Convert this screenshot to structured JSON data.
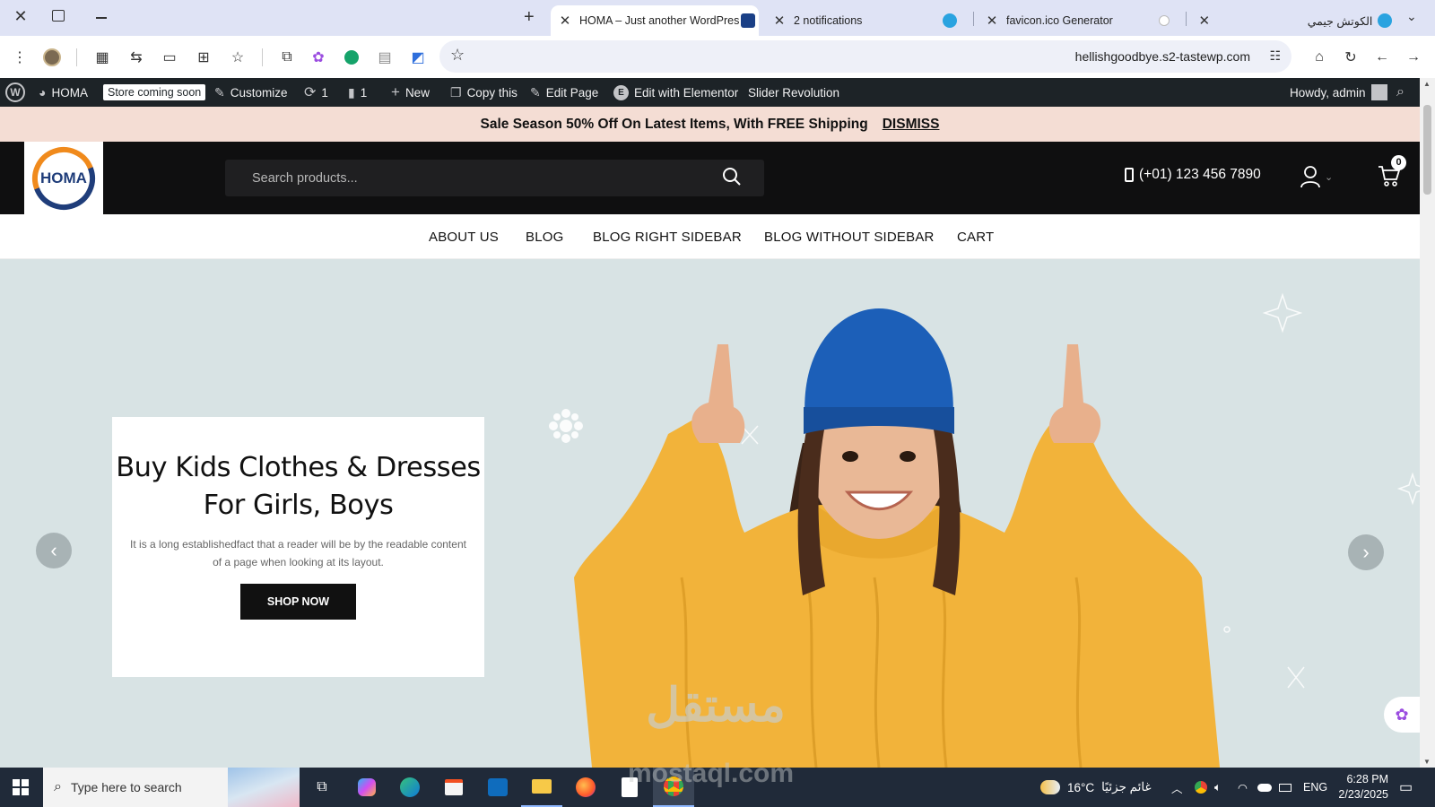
{
  "browser": {
    "tabs": [
      {
        "title": "HOMA – Just another WordPres",
        "active": true
      },
      {
        "title": "2 notifications",
        "active": false
      },
      {
        "title": "favicon.ico Generator",
        "active": false
      },
      {
        "title": "الكوتش جيمي",
        "active": false
      }
    ],
    "url": "hellishgoodbye.s2-tastewp.com"
  },
  "wp_admin_bar": {
    "site_name": "HOMA",
    "store_badge": "Store coming soon",
    "customize": "Customize",
    "updates_count": "1",
    "comments_count": "1",
    "new": "New",
    "copy_this": "Copy this",
    "edit_page": "Edit Page",
    "edit_elementor": "Edit with Elementor",
    "slider_revolution": "Slider Revolution",
    "howdy": "Howdy, admin"
  },
  "notice": {
    "text": "Sale Season 50% Off On Latest Items, With FREE Shipping",
    "dismiss": "DISMISS"
  },
  "header": {
    "logo_text": "HOMA",
    "search_placeholder": "Search products...",
    "phone": "(+01) 123 456 7890",
    "cart_count": "0"
  },
  "nav": {
    "items": [
      "ABOUT US",
      "BLOG",
      "BLOG RIGHT SIDEBAR",
      "BLOG WITHOUT SIDEBAR",
      "CART"
    ]
  },
  "hero": {
    "heading": "Buy Kids Clothes & Dresses For Girls, Boys",
    "description": "It is a long establishedfact that a reader will be by the readable content of a page when looking at its layout.",
    "button": "SHOP NOW",
    "watermark_top": "مستقل",
    "watermark_bottom": "mostaql.com"
  },
  "taskbar": {
    "search_placeholder": "Type here to search",
    "weather_temp": "16°C",
    "weather_desc": "غائم جزئيًا",
    "language": "ENG",
    "time": "6:28 PM",
    "date": "2/23/2025"
  },
  "colors": {
    "tabstrip": "#dfe3f5",
    "wpbar": "#1d2327",
    "notice": "#f4ddd4",
    "header": "#0f0f10",
    "hero": "#d8e3e4",
    "sweater": "#f2b33a",
    "beanie": "#1c5fb8",
    "logo_blue": "#1f3d7a",
    "logo_orange": "#f08a1c"
  }
}
